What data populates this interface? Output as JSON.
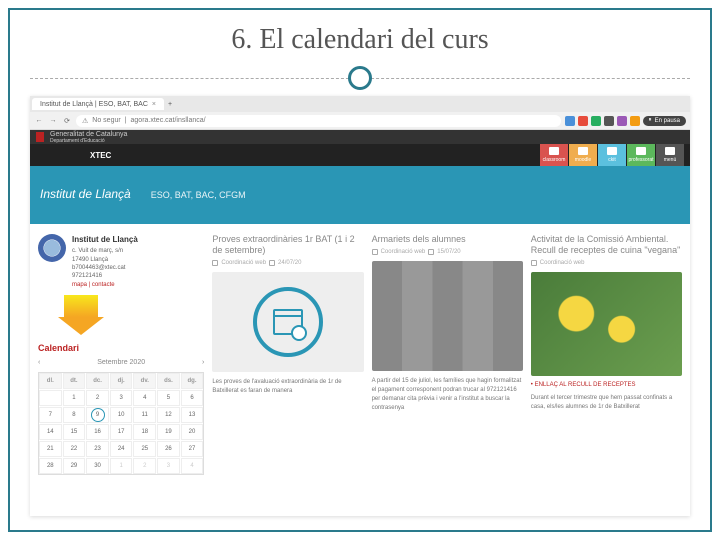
{
  "slide": {
    "title": "6. El calendari del curs"
  },
  "browser": {
    "tab_title": "Institut de Llançà | ESO, BAT, BAC",
    "tab_close": "×",
    "url_prefix": "No segur",
    "url": "agora.xtec.cat/insllanca/",
    "pause_label": "En pausa"
  },
  "gov": {
    "dept": "Generalitat de Catalunya",
    "sub": "Departament d'Educació",
    "brand": "XTEC"
  },
  "tiles": [
    {
      "label": "classroom"
    },
    {
      "label": "moodle"
    },
    {
      "label": "ckit"
    },
    {
      "label": "professorat"
    },
    {
      "label": "menú"
    }
  ],
  "hero": {
    "name": "Institut de Llançà",
    "tagline": "ESO, BAT, BAC, CFGM"
  },
  "school": {
    "name": "Institut de Llançà",
    "addr1": "c. Vuit de març, s/n",
    "addr2": "17490 Llançà",
    "email": "b7004463@xtec.cat",
    "phone": "972121416",
    "link_map": "mapa",
    "link_contact": "contacte"
  },
  "calendar": {
    "title": "Calendari",
    "month": "Setembre 2020",
    "days": [
      "dl.",
      "dt.",
      "dc.",
      "dj.",
      "dv.",
      "ds.",
      "dg."
    ],
    "rows": [
      [
        "",
        "1",
        "2",
        "3",
        "4",
        "5",
        "6"
      ],
      [
        "7",
        "8",
        "9",
        "10",
        "11",
        "12",
        "13"
      ],
      [
        "14",
        "15",
        "16",
        "17",
        "18",
        "19",
        "20"
      ],
      [
        "21",
        "22",
        "23",
        "24",
        "25",
        "26",
        "27"
      ],
      [
        "28",
        "29",
        "30",
        "1",
        "2",
        "3",
        "4"
      ]
    ],
    "today": "9"
  },
  "posts": [
    {
      "title": "Proves extraordinàries 1r BAT (1 i 2 de setembre)",
      "author": "Coordinació web",
      "date": "24/07/20",
      "body": "Les proves de l'avaluació extraordinària de 1r de Batxillerat es faran de manera"
    },
    {
      "title": "Armariets dels alumnes",
      "author": "Coordinació web",
      "date": "15/07/20",
      "body": "A partir del 15 de juliol, les famílies que hagin formalitzat el pagament corresponent podran trucar al 972121416 per demanar cita prèvia i venir a l'institut a buscar la contrasenya"
    },
    {
      "title": "Activitat de la Comissió Ambiental. Recull de receptes de cuina \"vegana\"",
      "author": "Coordinació web",
      "date": "",
      "link": "ENLLAÇ AL RECULL DE RECEPTES",
      "body": "Durant el tercer trimestre que hem passat confinats a casa, els/les alumnes de 1r de Batxillerat"
    }
  ]
}
